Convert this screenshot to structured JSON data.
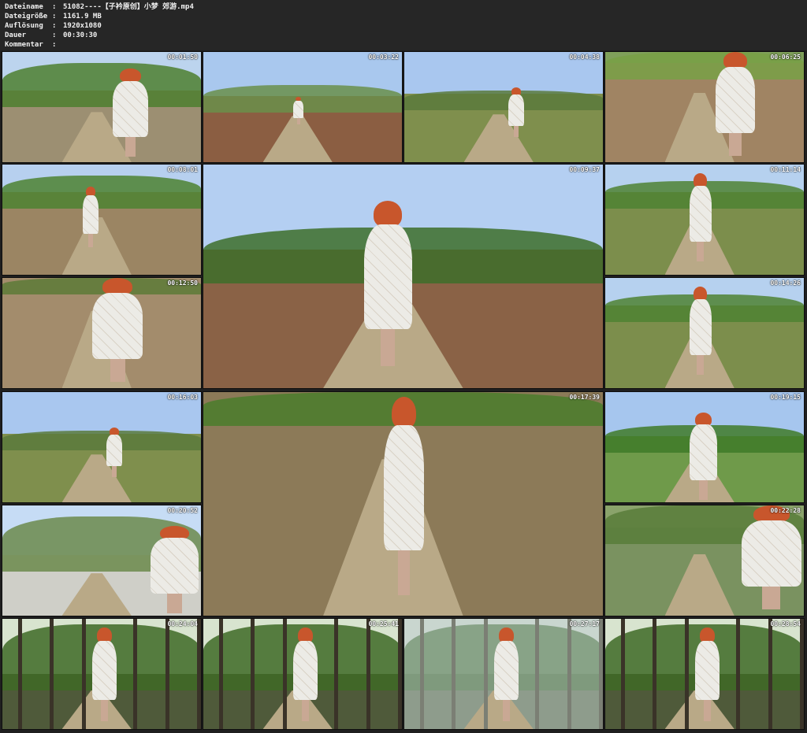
{
  "meta": [
    {
      "key": "Dateiname",
      "value": "51082----【子衿原创】小梦 郊游.mp4"
    },
    {
      "key": "Dateigröße",
      "value": "1161.9 MB"
    },
    {
      "key": "Auflösung",
      "value": "1920x1080"
    },
    {
      "key": "Dauer",
      "value": "00:30:30"
    },
    {
      "key": "Kommentar",
      "value": ""
    }
  ],
  "separator": ":",
  "thumbnails": [
    {
      "time": "00:01:50",
      "scene": "path-trees"
    },
    {
      "time": "00:03:22",
      "scene": "field-wall"
    },
    {
      "time": "00:04:38",
      "scene": "field-path"
    },
    {
      "time": "00:06:25",
      "scene": "legs-closeup"
    },
    {
      "time": "00:08:01",
      "scene": "path-bush"
    },
    {
      "time": "00:09:37",
      "scene": "field-wide"
    },
    {
      "time": "00:11:14",
      "scene": "path-figure"
    },
    {
      "time": "00:12:50",
      "scene": "closeup-walk"
    },
    {
      "time": "00:14:26",
      "scene": "path-figure"
    },
    {
      "time": "00:16:03",
      "scene": "field-path"
    },
    {
      "time": "00:17:39",
      "scene": "path-wide"
    },
    {
      "time": "00:19:15",
      "scene": "path-wall"
    },
    {
      "time": "00:20:52",
      "scene": "wall-closeup"
    },
    {
      "time": "00:22:28",
      "scene": "hair-closeup"
    },
    {
      "time": "00:24:04",
      "scene": "woods"
    },
    {
      "time": "00:25:41",
      "scene": "woods"
    },
    {
      "time": "00:27:17",
      "scene": "woods-smoke"
    },
    {
      "time": "00:28:54",
      "scene": "woods"
    }
  ]
}
